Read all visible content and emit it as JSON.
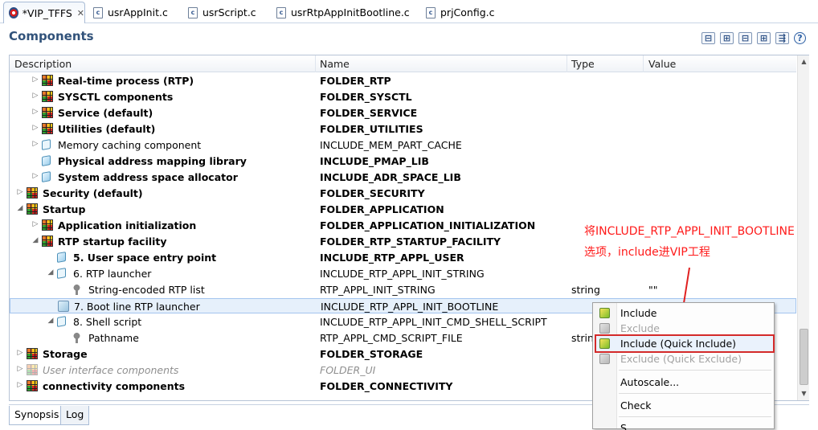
{
  "tabs": [
    {
      "label": "*VIP_TFFS",
      "icon": "vip-project-icon",
      "active": true,
      "closable": true
    },
    {
      "label": "usrAppInit.c",
      "icon": "c-file-icon"
    },
    {
      "label": "usrScript.c",
      "icon": "c-file-icon"
    },
    {
      "label": "usrRtpAppInitBootline.c",
      "icon": "c-file-icon"
    },
    {
      "label": "prjConfig.c",
      "icon": "c-file-icon"
    }
  ],
  "header": {
    "title": "Components",
    "tools": [
      "collapse-all-icon",
      "expand-all-icon",
      "collapse-icon",
      "expand-icon",
      "filter-icon",
      "help-icon"
    ],
    "tool_glyphs": [
      "⊟",
      "⊞",
      "⊟",
      "⊞",
      "⇶",
      "?"
    ]
  },
  "columns": {
    "description": "Description",
    "name": "Name",
    "type": "Type",
    "value": "Value"
  },
  "rows": [
    {
      "desc": "Real-time process (RTP)",
      "name": "FOLDER_RTP",
      "type": "",
      "value": "",
      "bold": true,
      "icon": "folder",
      "arrow": "▷",
      "level": 1
    },
    {
      "desc": "SYSCTL components",
      "name": "FOLDER_SYSCTL",
      "type": "",
      "value": "",
      "bold": true,
      "icon": "folder",
      "arrow": "▷",
      "level": 1
    },
    {
      "desc": "Service (default)",
      "name": "FOLDER_SERVICE",
      "type": "",
      "value": "",
      "bold": true,
      "icon": "folder",
      "arrow": "▷",
      "level": 1
    },
    {
      "desc": "Utilities (default)",
      "name": "FOLDER_UTILITIES",
      "type": "",
      "value": "",
      "bold": true,
      "icon": "folder",
      "arrow": "▷",
      "level": 1
    },
    {
      "desc": "Memory caching component",
      "name": "INCLUDE_MEM_PART_CACHE",
      "type": "",
      "value": "",
      "bold": false,
      "icon": "comp-hollow",
      "arrow": "▷",
      "level": 1
    },
    {
      "desc": "Physical address mapping library",
      "name": "INCLUDE_PMAP_LIB",
      "type": "",
      "value": "",
      "bold": true,
      "icon": "comp",
      "arrow": "",
      "level": 1
    },
    {
      "desc": "System address space allocator",
      "name": "INCLUDE_ADR_SPACE_LIB",
      "type": "",
      "value": "",
      "bold": true,
      "icon": "comp",
      "arrow": "▷",
      "level": 1
    },
    {
      "desc": "Security (default)",
      "name": "FOLDER_SECURITY",
      "type": "",
      "value": "",
      "bold": true,
      "icon": "folder",
      "arrow": "▷",
      "level": 0
    },
    {
      "desc": "Startup",
      "name": "FOLDER_APPLICATION",
      "type": "",
      "value": "",
      "bold": true,
      "icon": "folder",
      "arrow": "◢",
      "level": 0
    },
    {
      "desc": "Application initialization",
      "name": "FOLDER_APPLICATION_INITIALIZATION",
      "type": "",
      "value": "",
      "bold": true,
      "icon": "folder",
      "arrow": "▷",
      "level": 1
    },
    {
      "desc": "RTP startup facility",
      "name": "FOLDER_RTP_STARTUP_FACILITY",
      "type": "",
      "value": "",
      "bold": true,
      "icon": "folder",
      "arrow": "◢",
      "level": 1
    },
    {
      "desc": "5. User space entry point",
      "name": "INCLUDE_RTP_APPL_USER",
      "type": "",
      "value": "",
      "bold": true,
      "icon": "comp",
      "arrow": "",
      "level": 2
    },
    {
      "desc": "6. RTP launcher",
      "name": "INCLUDE_RTP_APPL_INIT_STRING",
      "type": "",
      "value": "",
      "bold": false,
      "icon": "comp-hollow",
      "arrow": "◢",
      "level": 2
    },
    {
      "desc": "String-encoded RTP list",
      "name": "RTP_APPL_INIT_STRING",
      "type": "string",
      "value": "\"\"",
      "bold": false,
      "icon": "param",
      "arrow": "",
      "level": 3
    },
    {
      "desc": "7. Boot line RTP launcher",
      "name": "INCLUDE_RTP_APPL_INIT_BOOTLINE",
      "type": "",
      "value": "",
      "bold": false,
      "icon": "paramsel",
      "arrow": "",
      "level": 2,
      "selected": true
    },
    {
      "desc": "8. Shell script",
      "name": "INCLUDE_RTP_APPL_INIT_CMD_SHELL_SCRIPT",
      "type": "",
      "value": "",
      "bold": false,
      "icon": "comp-hollow",
      "arrow": "◢",
      "level": 2
    },
    {
      "desc": "Pathname",
      "name": "RTP_APPL_CMD_SCRIPT_FILE",
      "type": "string",
      "value": "",
      "bold": false,
      "icon": "param",
      "arrow": "",
      "level": 3
    },
    {
      "desc": "Storage",
      "name": "FOLDER_STORAGE",
      "type": "",
      "value": "",
      "bold": true,
      "icon": "folder",
      "arrow": "▷",
      "level": 0
    },
    {
      "desc": "User interface components",
      "name": "FOLDER_UI",
      "type": "",
      "value": "",
      "bold": false,
      "dim": true,
      "icon": "folder-dim",
      "arrow": "▷",
      "level": 0
    },
    {
      "desc": "connectivity components",
      "name": "FOLDER_CONNECTIVITY",
      "type": "",
      "value": "",
      "bold": true,
      "icon": "folder",
      "arrow": "▷",
      "level": 0
    }
  ],
  "bottom_tabs": [
    "Synopsis",
    "Log"
  ],
  "annotation": {
    "line1": "将INCLUDE_RTP_APPL_INIT_BOOTLINE",
    "line2": "选项，include进VIP工程"
  },
  "context_menu": [
    {
      "label": "Include",
      "icon": "include-icon",
      "enabled": true
    },
    {
      "label": "Exclude",
      "icon": "exclude-icon",
      "enabled": false
    },
    {
      "label": "Include (Quick Include)",
      "icon": "include-icon",
      "enabled": true,
      "highlight": true
    },
    {
      "label": "Exclude (Quick Exclude)",
      "icon": "exclude-icon",
      "enabled": false
    },
    {
      "separator": true
    },
    {
      "label": "Autoscale...",
      "enabled": true
    },
    {
      "separator": true
    },
    {
      "label": "Check",
      "enabled": true
    },
    {
      "separator": true
    },
    {
      "label": "S...",
      "enabled": true
    }
  ]
}
